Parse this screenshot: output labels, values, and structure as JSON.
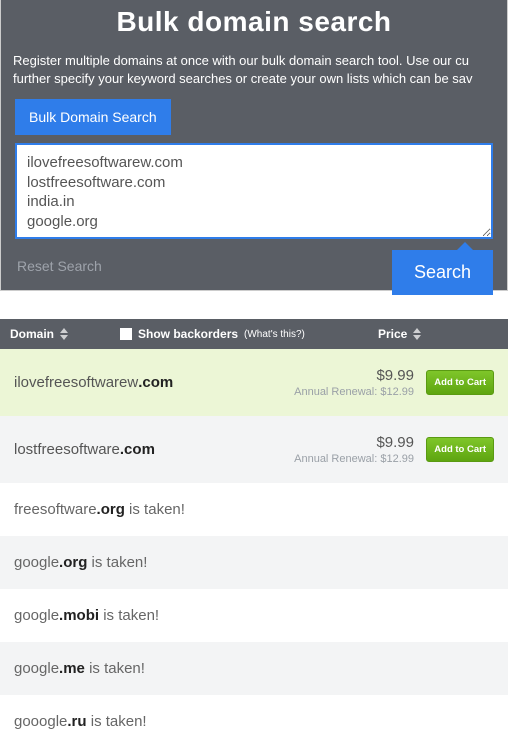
{
  "header": {
    "title": "Bulk domain search",
    "desc": "Register multiple domains at once with our bulk domain search tool. Use our cu further specify your keyword searches or create your own lists which can be sav"
  },
  "tab": {
    "label": "Bulk Domain Search"
  },
  "textarea": {
    "value": "ilovefreesoftwarew.com\nlostfreesoftware.com\nindia.in\ngoogle.org"
  },
  "reset": {
    "label": "Reset Search"
  },
  "search": {
    "label": "Search"
  },
  "thead": {
    "domain": "Domain",
    "show_backorders": "Show backorders",
    "whats_this": "(What's this?)",
    "price": "Price"
  },
  "cart_label": "Add to Cart",
  "rows": {
    "r0": {
      "name": "ilovefreesoftwarew",
      "tld": ".com",
      "price": "$9.99",
      "renew": "Annual Renewal: $12.99"
    },
    "r1": {
      "name": "lostfreesoftware",
      "tld": ".com",
      "price": "$9.99",
      "renew": "Annual Renewal: $12.99"
    },
    "r2": {
      "name": "freesoftware",
      "tld": ".org",
      "suffix": " is taken!"
    },
    "r3": {
      "name": "google",
      "tld": ".org",
      "suffix": " is taken!"
    },
    "r4": {
      "name": "google",
      "tld": ".mobi",
      "suffix": " is taken!"
    },
    "r5": {
      "name": "google",
      "tld": ".me",
      "suffix": " is taken!"
    },
    "r6": {
      "name": "gooogle",
      "tld": ".ru",
      "suffix": " is taken!"
    }
  }
}
